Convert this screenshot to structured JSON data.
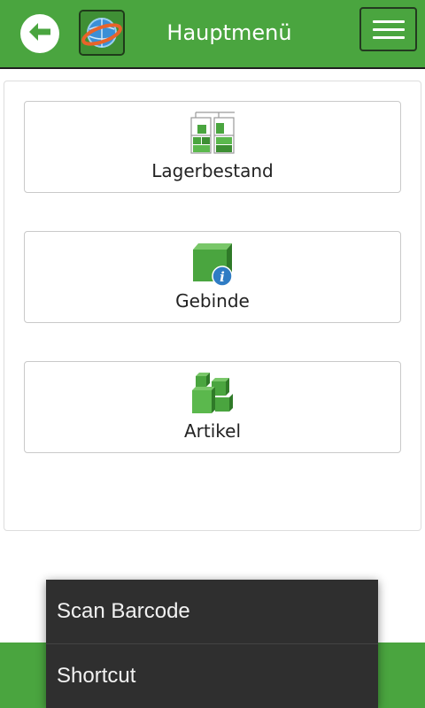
{
  "header": {
    "title": "Hauptmenü",
    "back_icon": "arrow-left-icon",
    "logo_icon": "globe-orbit-logo",
    "menu_icon": "hamburger-menu-icon",
    "background": "#4aa53f"
  },
  "menu_tiles": [
    {
      "label": "Lagerbestand",
      "icon": "shelf-stock-icon"
    },
    {
      "label": "Gebinde",
      "icon": "container-info-icon"
    },
    {
      "label": "Artikel",
      "icon": "stacked-boxes-icon"
    }
  ],
  "popup_menu": {
    "items": [
      {
        "label": "Scan Barcode"
      },
      {
        "label": "Shortcut"
      }
    ],
    "background": "#2f2f2f"
  }
}
